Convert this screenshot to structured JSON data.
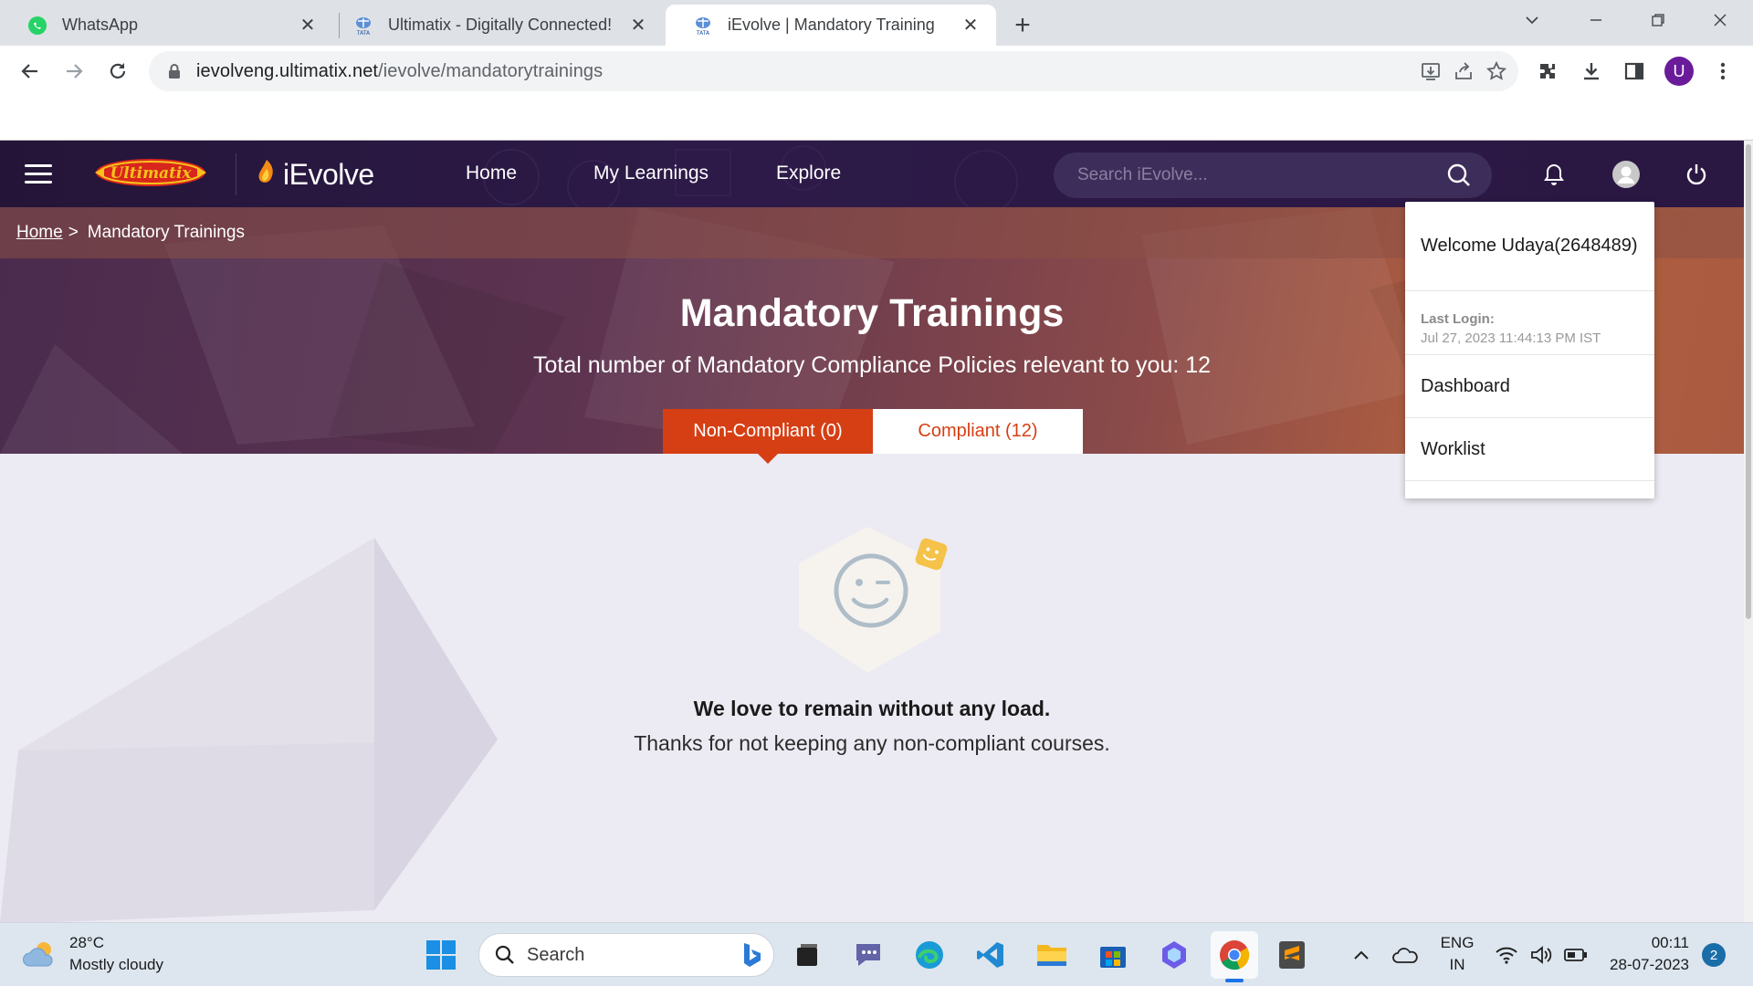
{
  "browser": {
    "tabs": [
      {
        "title": "WhatsApp",
        "icon": "whatsapp-icon"
      },
      {
        "title": "Ultimatix - Digitally Connected!",
        "icon": "tata-icon"
      },
      {
        "title": "iEvolve | Mandatory Training",
        "icon": "tata-icon"
      }
    ],
    "url_domain": "ievolveng.ultimatix.net",
    "url_path": "/ievolve/mandatorytrainings",
    "profile_letter": "U"
  },
  "app": {
    "logo_brand": "Ultimatix",
    "logo_product": "iEvolve",
    "nav": [
      "Home",
      "My Learnings",
      "Explore"
    ],
    "search_placeholder": "Search iEvolve..."
  },
  "breadcrumb": {
    "home": "Home",
    "separator": ">",
    "current": "Mandatory Trainings"
  },
  "hero": {
    "title": "Mandatory Trainings",
    "subtitle": "Total number of Mandatory Compliance Policies relevant to you: 12"
  },
  "tabs": [
    {
      "label": "Non-Compliant (0)",
      "active": true
    },
    {
      "label": "Compliant (12)",
      "active": false
    }
  ],
  "empty_state": {
    "title": "We love to remain without any load.",
    "message": "Thanks for not keeping any non-compliant courses."
  },
  "profile_menu": {
    "welcome": "Welcome Udaya(2648489)",
    "last_login_label": "Last Login:",
    "last_login_value": "Jul 27, 2023 11:44:13 PM IST",
    "items": [
      "Dashboard",
      "Worklist"
    ]
  },
  "taskbar": {
    "weather_temp": "28°C",
    "weather_desc": "Mostly cloudy",
    "search_label": "Search",
    "lang_line1": "ENG",
    "lang_line2": "IN",
    "time": "00:11",
    "date": "28-07-2023",
    "notification_count": "2"
  },
  "colors": {
    "accent": "#d63f14",
    "header": "#2a1742",
    "chrome_tabstrip": "#dee1e6"
  }
}
